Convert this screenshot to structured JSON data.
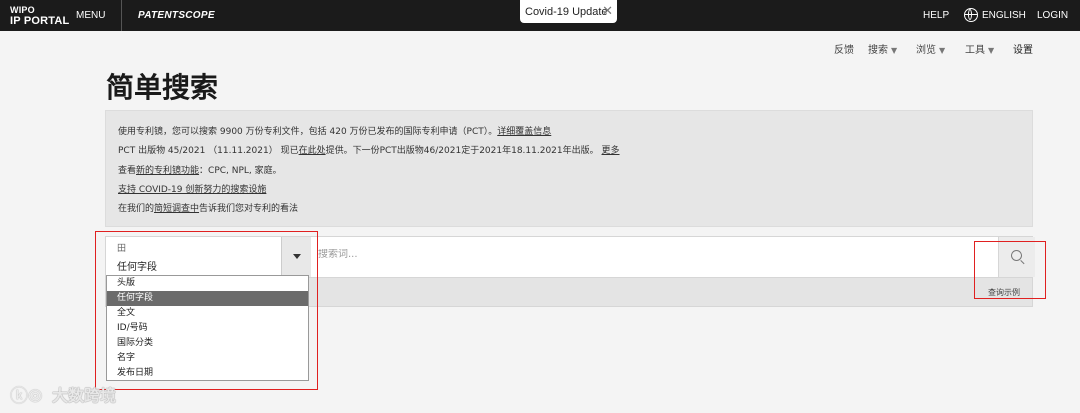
{
  "topbar": {
    "logo_line1": "WIPO",
    "logo_line2": "IP PORTAL",
    "menu": "MENU",
    "brand": "PATENTSCOPE",
    "covid_tab": "Covid-19 Update",
    "help": "HELP",
    "language": "ENGLISH",
    "login": "LOGIN"
  },
  "subnav": {
    "feedback": "反馈",
    "search": "搜索",
    "browse": "浏览",
    "tools": "工具",
    "settings": "设置"
  },
  "page_title": "简单搜索",
  "info": {
    "line1_text": "使用专利镜，您可以搜索 9900 万份专利文件，包括 420 万份已发布的国际专利申请（PCT）。",
    "line1_link": "详细覆盖信息",
    "line2_a": "PCT 出版物 45/2021 （11.11.2021） 现已",
    "line2_link1": "在此处",
    "line2_b": "提供。下一份PCT出版物46/2021定于2021年18.11.2021年出版。",
    "line2_link2": "更多",
    "line3_a": "查看",
    "line3_link": "新的专利镜功能",
    "line3_b": "：CPC, NPL, 家庭。",
    "line4_link": "支持 COVID-19 创新努力的搜索设施",
    "line5_a": "在我们的",
    "line5_link": "简短调查中",
    "line5_b": "告诉我们您对专利的看法"
  },
  "search": {
    "field_icon": "田",
    "field_value": "任何字段",
    "placeholder": "搜索词...",
    "examples": "查询示例"
  },
  "dropdown": {
    "options": [
      "头版",
      "任何字段",
      "全文",
      "ID/号码",
      "国际分类",
      "名字",
      "发布日期"
    ],
    "selected": "任何字段"
  },
  "watermark": "大数跨境",
  "colors": {
    "topbar": "#1b1b1b",
    "annotation": "#e02020",
    "selected_option": "#6b6b6b"
  }
}
